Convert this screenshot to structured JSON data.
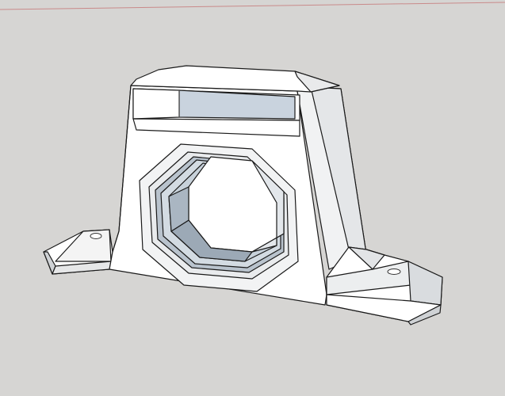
{
  "viewport": {
    "background": "#d6d5d3",
    "horizon_line_color": "#c98a8a"
  },
  "model": {
    "face_color": "#ffffff",
    "shaded_face_color": "#dfe1e3",
    "inner_face_color": "#c9d3de",
    "inner_shadow_color": "#b7c2cd",
    "edge_color": "#1a1a1a",
    "hole_count": 2
  }
}
